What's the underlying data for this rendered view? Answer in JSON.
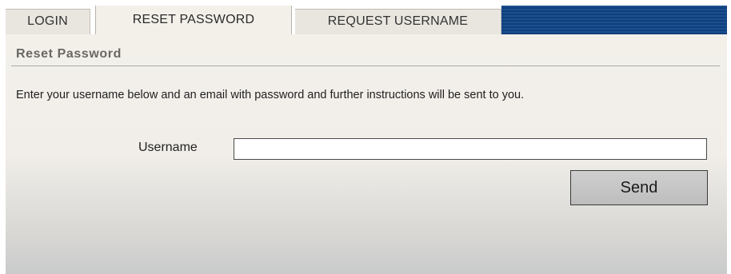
{
  "tabs": [
    {
      "label": "LOGIN",
      "active": false
    },
    {
      "label": "RESET PASSWORD",
      "active": true
    },
    {
      "label": "REQUEST USERNAME",
      "active": false
    }
  ],
  "section": {
    "title": "Reset Password",
    "instructions": "Enter your username below and an email with password and further instructions will be sent to you."
  },
  "form": {
    "username_label": "Username",
    "username_value": "",
    "send_label": "Send"
  },
  "colors": {
    "tab_bar_accent": "#1a4f8f",
    "panel_background": "#f3f0ea",
    "active_tab": "#f3f0ea",
    "inactive_tab": "#e9e6e0"
  }
}
